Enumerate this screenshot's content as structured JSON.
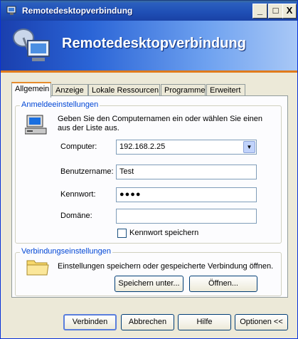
{
  "window": {
    "title": "Remotedesktopverbindung"
  },
  "titlebar_buttons": {
    "minimize": "_",
    "maximize": "□",
    "close": "X"
  },
  "banner": {
    "title": "Remotedesktopverbindung"
  },
  "tabs": [
    {
      "label": "Allgemein",
      "active": true
    },
    {
      "label": "Anzeige",
      "active": false
    },
    {
      "label": "Lokale Ressourcen",
      "active": false
    },
    {
      "label": "Programme",
      "active": false
    },
    {
      "label": "Erweitert",
      "active": false
    }
  ],
  "logon_group": {
    "label": "Anmeldeeinstellungen",
    "description_line1": "Geben Sie den Computernamen ein oder wählen Sie einen",
    "description_line2": "aus der Liste aus.",
    "computer_label": "Computer:",
    "computer_value": "192.168.2.25",
    "username_label": "Benutzername:",
    "username_value": "Test",
    "password_label": "Kennwort:",
    "password_value": "●●●●",
    "domain_label": "Domäne:",
    "domain_value": "",
    "save_password_label": "Kennwort speichern"
  },
  "connection_group": {
    "label": "Verbindungseinstellungen",
    "description": "Einstellungen speichern oder gespeicherte Verbindung öffnen.",
    "save_as_button": "Speichern unter...",
    "open_button": "Öffnen..."
  },
  "footer_buttons": {
    "connect": "Verbinden",
    "cancel": "Abbrechen",
    "help": "Hilfe",
    "options": "Optionen <<"
  },
  "colors": {
    "titlebar": "#1f4fb5",
    "accent_orange": "#e07b1c",
    "group_label": "#0046d5"
  }
}
